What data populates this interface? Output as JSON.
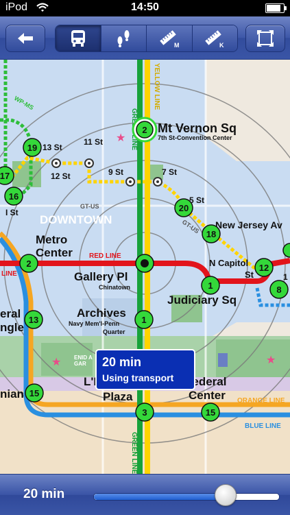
{
  "status_bar": {
    "carrier": "iPod",
    "time": "14:50"
  },
  "toolbar": {
    "back_icon": "back-arrow-icon",
    "modes": [
      {
        "icon": "bus-icon",
        "selected": true
      },
      {
        "icon": "footprints-icon",
        "selected": false
      },
      {
        "icon": "ruler-icon",
        "unit": "M",
        "selected": false
      },
      {
        "icon": "ruler-icon",
        "unit": "K",
        "selected": false
      }
    ],
    "fit_icon": "fit-screen-icon"
  },
  "map": {
    "area_label": "DOWNTOWN",
    "line_labels": {
      "green": "GREEN LINE",
      "yellow": "YELLOW LINE",
      "red": "RED LINE",
      "orange": "ORANGE LINE",
      "blue": "BLUE LINE",
      "wp_ms": "WP-MS",
      "gt_us_1": "GT-US",
      "gt_us_2": "GT-US"
    },
    "stations": {
      "mt_vernon": "Mt Vernon Sq",
      "mt_vernon_sub": "7th St-Convention Center",
      "13st": "13 St",
      "11st": "11 St",
      "12st": "12 St",
      "9st": "9 St",
      "7st": "7 St",
      "5st": "5 St",
      "ist": "I St",
      "metro_center_1": "Metro",
      "metro_center_2": "Center",
      "new_jersey": "New Jersey Av",
      "n_capitol_1": "N Capitol",
      "n_capitol_2": "St",
      "gallery": "Gallery Pl",
      "gallery_sub": "Chinatown",
      "judiciary": "Judiciary Sq",
      "archives": "Archives",
      "archives_sub_1": "Navy Mem'l-Penn",
      "archives_sub_2": "Quarter",
      "federal_left_1": "eral",
      "federal_left_2": "ngle",
      "lenfant_1": "L'E",
      "lenfant_2": "Plaza",
      "enid": "ENID A",
      "enid_2": "GAR",
      "federal_center_1": "Federal",
      "federal_center_2": "Center",
      "smithsonian": "nian",
      "partial_1": "1",
      "edge_line": "LINE"
    },
    "route_numbers": {
      "r2": "2",
      "r19": "19",
      "r17": "17",
      "r16": "16",
      "r20": "20",
      "r18": "18",
      "r2b": "2",
      "r12": "12",
      "r1a": "1",
      "r8": "8",
      "r13": "13",
      "r1b": "1",
      "r15a": "15",
      "r3": "3",
      "r15b": "15"
    },
    "info_box": {
      "time": "20 min",
      "subtitle": "Using transport"
    }
  },
  "bottom_bar": {
    "label": "20 min",
    "slider_fraction": 0.71
  }
}
